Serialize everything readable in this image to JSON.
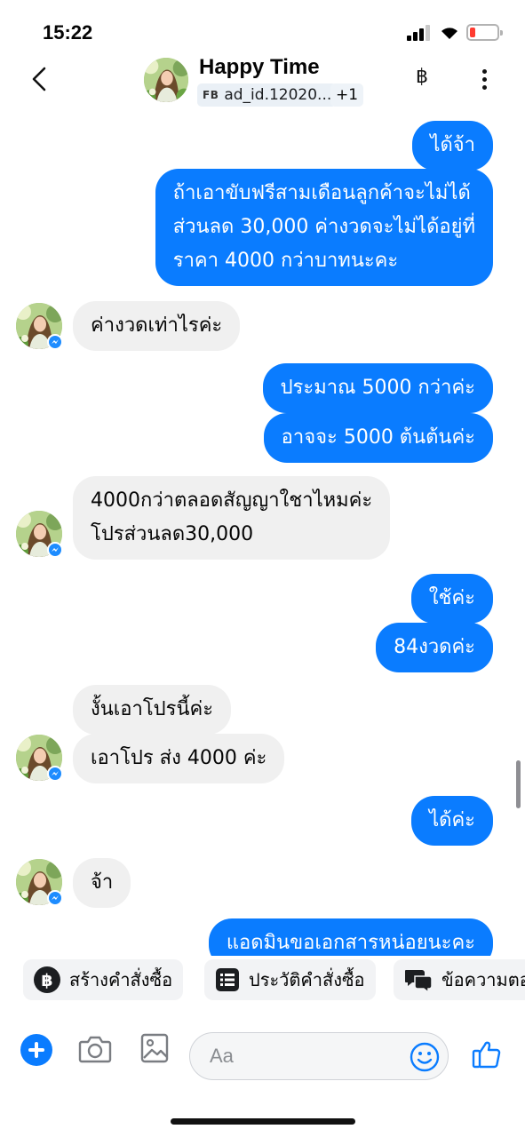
{
  "status_bar": {
    "time": "15:22"
  },
  "header": {
    "contact_name": "Happy Time",
    "ad_source": "FB",
    "ad_id": "ad_id.12020...",
    "extra_count": "+1",
    "currency_symbol": "฿"
  },
  "messages": [
    {
      "side": "out",
      "lines": [
        "ได้จ้า"
      ]
    },
    {
      "side": "out",
      "lines": [
        "ถ้าเอาขับฟรีสามเดือนลูกค้าจะไม่ได้",
        "ส่วนลด 30,000 ค่างวดจะไม่ได้อยู่ที่",
        "ราคา 4000 กว่าบาทนะคะ"
      ]
    },
    {
      "side": "in",
      "lines": [
        "ค่างวดเท่าไรค่ะ"
      ]
    },
    {
      "side": "out",
      "lines": [
        "ประมาณ 5000 กว่าค่ะ"
      ]
    },
    {
      "side": "out",
      "lines": [
        "อาจจะ 5000 ต้นต้นค่ะ"
      ]
    },
    {
      "side": "in",
      "lines": [
        "4000กว่าตลอดสัญญาใชาไหมค่ะ",
        "โปรส่วนลด30,000"
      ]
    },
    {
      "side": "out",
      "lines": [
        "ใช้ค่ะ"
      ]
    },
    {
      "side": "out",
      "lines": [
        "84งวดค่ะ"
      ]
    },
    {
      "side": "in",
      "lines": [
        "งั้นเอาโปรนี้ค่ะ"
      ]
    },
    {
      "side": "in",
      "lines": [
        "เอาโปร ส่ง 4000 ค่ะ"
      ]
    },
    {
      "side": "out",
      "lines": [
        "ได้ค่ะ"
      ]
    },
    {
      "side": "in",
      "lines": [
        "จ้า"
      ]
    },
    {
      "side": "out",
      "lines": [
        "แอดมินขอเอกสารหน่อยนะคะ"
      ]
    }
  ],
  "quick_actions": [
    {
      "label": "สร้างคำสั่งซื้อ",
      "icon": "baht-circle-icon"
    },
    {
      "label": "ประวัติคำสั่งซื้อ",
      "icon": "list-icon"
    },
    {
      "label": "ข้อความตอ",
      "icon": "chat-bubbles-icon"
    }
  ],
  "composer": {
    "placeholder": "Aa"
  },
  "colors": {
    "accent": "#0A7CFF",
    "incoming_bubble": "#F0F0F0"
  }
}
